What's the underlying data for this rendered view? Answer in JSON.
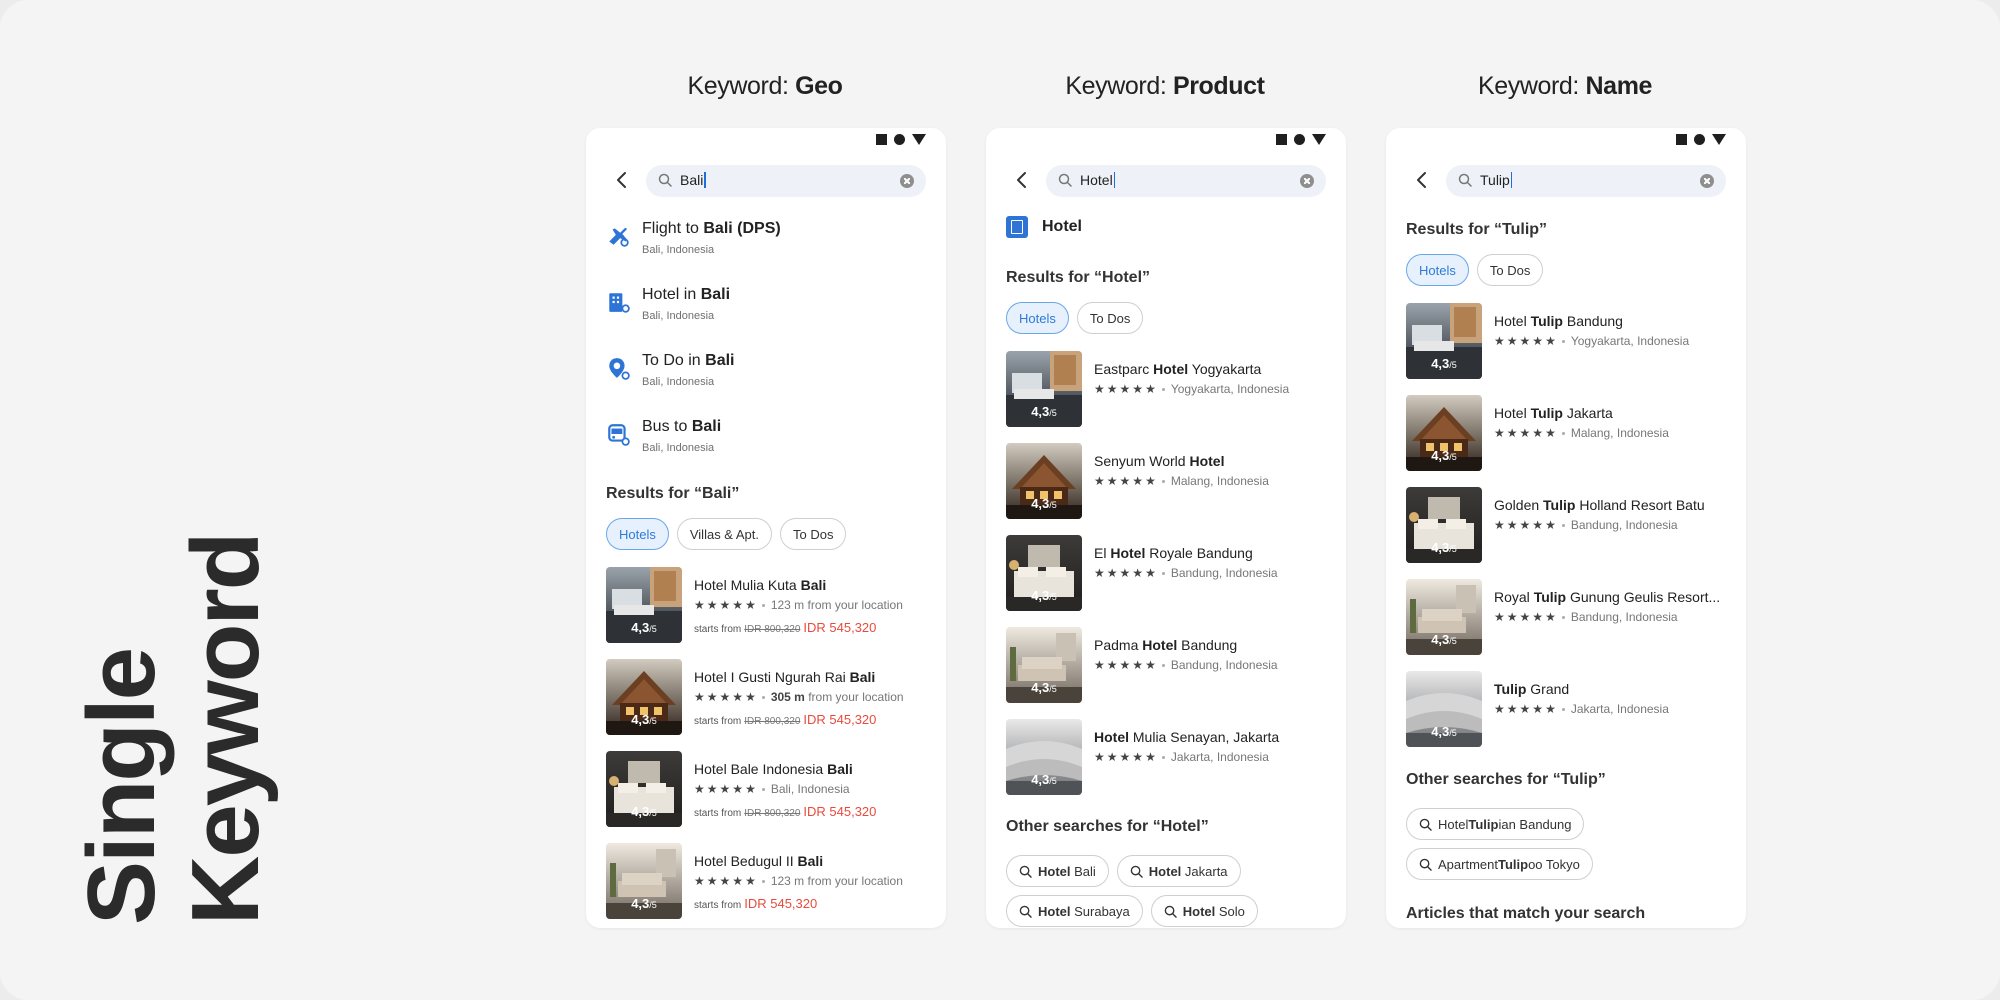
{
  "side_title": [
    "Single",
    "Keyword"
  ],
  "columns": [
    {
      "head_prefix": "Keyword: ",
      "head_bold": "Geo",
      "query": "Bali",
      "suggestions": [
        {
          "icon": "flight-search-icon",
          "pre": "Flight to ",
          "bold": "Bali (DPS)",
          "post": "",
          "sub": "Bali, Indonesia"
        },
        {
          "icon": "hotel-search-icon",
          "pre": "Hotel in ",
          "bold": "Bali",
          "post": "",
          "sub": "Bali, Indonesia"
        },
        {
          "icon": "todo-search-icon",
          "pre": "To Do in ",
          "bold": "Bali",
          "post": "",
          "sub": "Bali, Indonesia"
        },
        {
          "icon": "bus-search-icon",
          "pre": "Bus to ",
          "bold": "Bali",
          "post": "",
          "sub": "Bali, Indonesia"
        }
      ],
      "results_title": "Results for “Bali”",
      "chips": [
        {
          "label": "Hotels",
          "active": true
        },
        {
          "label": "Villas & Apt.",
          "active": false
        },
        {
          "label": "To Dos",
          "active": false
        }
      ],
      "cards": [
        {
          "pre": "Hotel Mulia Kuta ",
          "bold": "Bali",
          "post": "",
          "rating": "4,3",
          "rating_suffix": "/5",
          "dist_bold": "",
          "meta": "123 m from your location",
          "starts": "starts from",
          "old": "IDR 800,320",
          "price": "IDR 545,320",
          "img": "room"
        },
        {
          "pre": "Hotel I Gusti Ngurah Rai ",
          "bold": "Bali",
          "post": "",
          "rating": "4,3",
          "rating_suffix": "/5",
          "dist_bold": "305 m",
          "meta": " from your location",
          "starts": "starts from",
          "old": "IDR 800,320",
          "price": "IDR 545,320",
          "img": "house"
        },
        {
          "pre": "Hotel Bale Indonesia ",
          "bold": "Bali",
          "post": "",
          "rating": "4,3",
          "rating_suffix": "/5",
          "dist_bold": "",
          "meta": "Bali, Indonesia",
          "starts": "starts from",
          "old": "IDR 800,320",
          "price": "IDR 545,320",
          "img": "bed"
        },
        {
          "pre": "Hotel Bedugul II ",
          "bold": "Bali",
          "post": "",
          "rating": "4,3",
          "rating_suffix": "/5",
          "dist_bold": "",
          "meta": "123 m from your location",
          "starts": "starts from",
          "old": "",
          "price": "IDR 545,320",
          "img": "lounge"
        }
      ]
    },
    {
      "head_prefix": "Keyword: ",
      "head_bold": "Product",
      "query": "Hotel",
      "product": "Hotel",
      "results_title": "Results for “Hotel”",
      "chips": [
        {
          "label": "Hotels",
          "active": true
        },
        {
          "label": "To Dos",
          "active": false
        }
      ],
      "cards": [
        {
          "pre": "Eastparc ",
          "bold": "Hotel",
          "post": " Yogyakarta",
          "rating": "4,3",
          "rating_suffix": "/5",
          "meta": "Yogyakarta, Indonesia",
          "img": "room"
        },
        {
          "pre": "Senyum World ",
          "bold": "Hotel",
          "post": "",
          "rating": "4,3",
          "rating_suffix": "/5",
          "meta": "Malang, Indonesia",
          "img": "house"
        },
        {
          "pre": "El ",
          "bold": "Hotel",
          "post": " Royale Bandung",
          "rating": "4,3",
          "rating_suffix": "/5",
          "meta": "Bandung, Indonesia",
          "img": "bed"
        },
        {
          "pre": "Padma ",
          "bold": "Hotel",
          "post": " Bandung",
          "rating": "4,3",
          "rating_suffix": "/5",
          "meta": "Bandung, Indonesia",
          "img": "lounge"
        },
        {
          "pre": "",
          "bold": "Hotel",
          "post": " Mulia Senayan, Jakarta",
          "rating": "4,3",
          "rating_suffix": "/5",
          "meta": "Jakarta, Indonesia",
          "img": "pillows"
        }
      ],
      "other_title": "Other searches for “Hotel”",
      "other_chips": [
        {
          "bold": "Hotel",
          "rest": " Bali"
        },
        {
          "bold": "Hotel",
          "rest": " Jakarta"
        },
        {
          "bold": "Hotel",
          "rest": " Surabaya"
        },
        {
          "bold": "Hotel",
          "rest": " Solo"
        }
      ]
    },
    {
      "head_prefix": "Keyword: ",
      "head_bold": "Name",
      "query": "Tulip",
      "results_title": "Results for “Tulip”",
      "chips": [
        {
          "label": "Hotels",
          "active": true
        },
        {
          "label": "To Dos",
          "active": false
        }
      ],
      "cards": [
        {
          "pre": "Hotel ",
          "bold": "Tulip",
          "post": " Bandung",
          "rating": "4,3",
          "rating_suffix": "/5",
          "meta": "Yogyakarta, Indonesia",
          "img": "room"
        },
        {
          "pre": "Hotel ",
          "bold": "Tulip",
          "post": " Jakarta",
          "rating": "4,3",
          "rating_suffix": "/5",
          "meta": "Malang, Indonesia",
          "img": "house"
        },
        {
          "pre": "Golden ",
          "bold": "Tulip",
          "post": " Holland Resort Batu",
          "rating": "4,3",
          "rating_suffix": "/5",
          "meta": "Bandung, Indonesia",
          "img": "bed"
        },
        {
          "pre": "Royal ",
          "bold": "Tulip",
          "post": " Gunung Geulis Resort...",
          "rating": "4,3",
          "rating_suffix": "/5",
          "meta": "Bandung, Indonesia",
          "img": "lounge"
        },
        {
          "pre": "",
          "bold": "Tulip",
          "post": " Grand",
          "rating": "4,3",
          "rating_suffix": "/5",
          "meta": "Jakarta, Indonesia",
          "img": "pillows"
        }
      ],
      "other_title": "Other searches for “Tulip”",
      "other_chips": [
        {
          "pre": "Hotel ",
          "bold": "Tulip",
          "rest": "ian Bandung"
        },
        {
          "pre": "Apartment ",
          "bold": "Tulip",
          "rest": "oo Tokyo"
        }
      ],
      "articles_title": "Articles that match your search"
    }
  ],
  "colors": {
    "accent": "#2f7ad8",
    "price": "#e84b3c",
    "chip_active_bg": "#e7f1fd"
  }
}
